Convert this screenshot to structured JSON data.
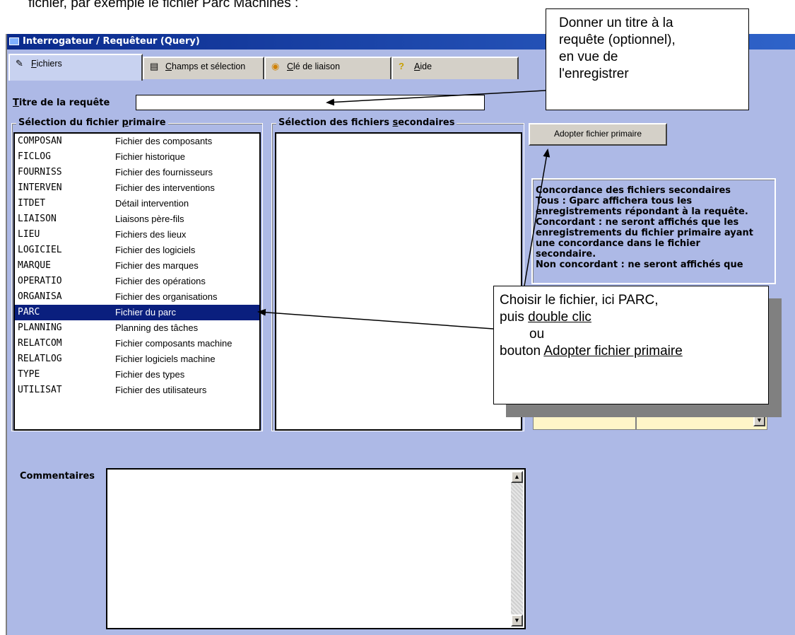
{
  "doc": {
    "text": "fichier, par exemple le fichier Parc Machines :"
  },
  "window": {
    "title": "Interrogateur / Requêteur (Query)"
  },
  "tabs": [
    {
      "label_ul": "F",
      "label_rest": "ichiers",
      "icon": "pencil-icon"
    },
    {
      "label_ul": "C",
      "label_rest": "hamps et sélection",
      "icon": "fields-icon"
    },
    {
      "label_ul": "C",
      "label_rest": "lé de liaison",
      "icon": "disc-icon"
    },
    {
      "label_ul": "A",
      "label_rest": "ide",
      "icon": "question-icon"
    }
  ],
  "query_title": {
    "label_ul": "T",
    "label_rest": "itre de la requête",
    "value": ""
  },
  "primary": {
    "legend_start": "Sélection du fichier ",
    "legend_ul": "p",
    "legend_end": "rimaire",
    "items": [
      {
        "code": "COMPOSAN",
        "desc": "Fichier des composants"
      },
      {
        "code": "FICLOG",
        "desc": "Fichier historique"
      },
      {
        "code": "FOURNISS",
        "desc": "Fichier des fournisseurs"
      },
      {
        "code": "INTERVEN",
        "desc": "Fichier des interventions"
      },
      {
        "code": "ITDET",
        "desc": "Détail intervention"
      },
      {
        "code": "LIAISON",
        "desc": "Liaisons père-fils"
      },
      {
        "code": "LIEU",
        "desc": "Fichiers des lieux"
      },
      {
        "code": "LOGICIEL",
        "desc": "Fichier des logiciels"
      },
      {
        "code": "MARQUE",
        "desc": "Fichier des marques"
      },
      {
        "code": "OPERATIO",
        "desc": "Fichier des opérations"
      },
      {
        "code": "ORGANISA",
        "desc": "Fichier des organisations"
      },
      {
        "code": "PARC",
        "desc": "Fichier du parc",
        "selected": true
      },
      {
        "code": "PLANNING",
        "desc": "Planning des tâches"
      },
      {
        "code": "RELATCOM",
        "desc": "Fichier composants machine"
      },
      {
        "code": "RELATLOG",
        "desc": "Fichier logiciels machine"
      },
      {
        "code": "TYPE",
        "desc": "Fichier des types"
      },
      {
        "code": "UTILISAT",
        "desc": "Fichier des utilisateurs"
      }
    ]
  },
  "secondary": {
    "legend_start": "Sélection des fichiers ",
    "legend_ul": "s",
    "legend_end": "econdaires"
  },
  "adopt_button": {
    "label": "Adopter fichier primaire"
  },
  "info_panel": {
    "lines": [
      "Concordance des fichiers secondaires",
      "Tous : Gparc affichera tous les",
      "enregistrements répondant à la requête.",
      "Concordant : ne seront affichés que les",
      "enregistrements du fichier primaire ayant",
      "une concordance dans le fichier",
      "secondaire.",
      "Non concordant : ne seront affichés que"
    ]
  },
  "comments": {
    "label": "Commentaires",
    "value": ""
  },
  "callout_title": {
    "lines": [
      "Donner un titre à la",
      "requête (optionnel),",
      "en vue de",
      "l'enregistrer"
    ]
  },
  "callout_choose": {
    "line1": "Choisir le fichier, ici PARC,",
    "line2_start": "puis ",
    "line2_ul": "double clic",
    "line3": "ou",
    "line4_start": "bouton ",
    "line4_ul": "Adopter fichier primaire"
  },
  "colors": {
    "window_bg": "#adb9e6",
    "titlebar": "#0a2a8c",
    "selection": "#0a1f7e",
    "tab_bg": "#d4d0c8",
    "combo_bg": "#fff5c8"
  }
}
